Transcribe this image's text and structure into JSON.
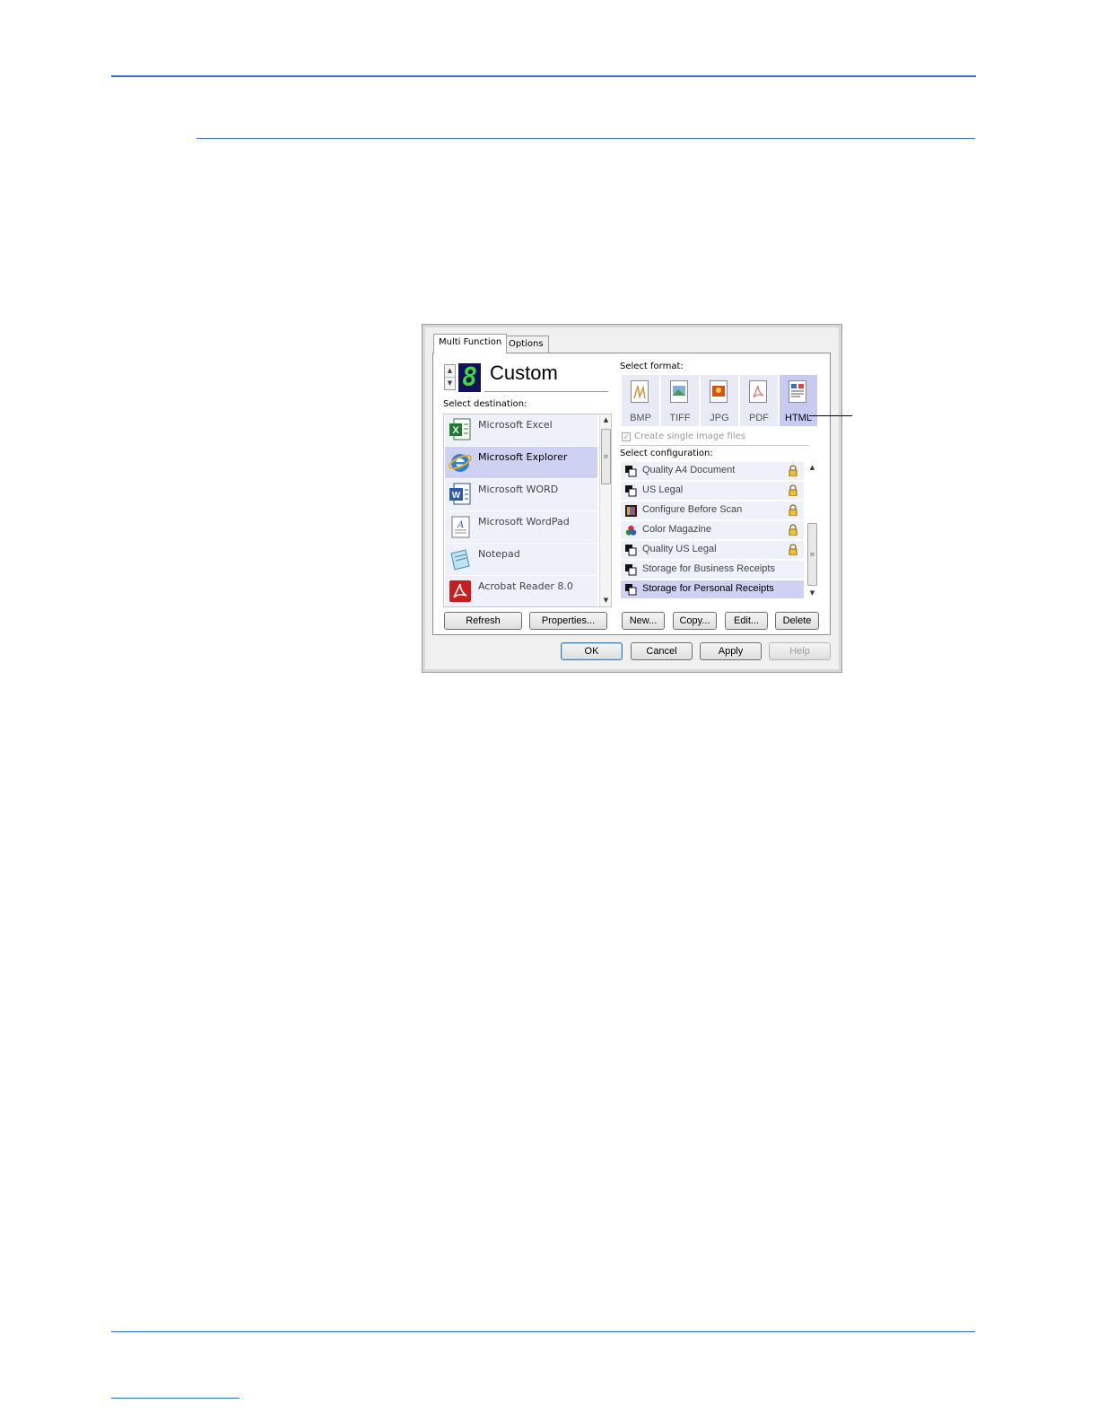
{
  "dialog": {
    "tabs": [
      {
        "label": "Multi Function",
        "active": true
      },
      {
        "label": "Options",
        "active": false
      }
    ],
    "profile": {
      "digit": "8",
      "name": "Custom"
    },
    "destination": {
      "label": "Select destination:",
      "items": [
        {
          "label": "Microsoft Excel",
          "icon": "excel-icon",
          "selected": false
        },
        {
          "label": "Microsoft Explorer",
          "icon": "internet-explorer-icon",
          "selected": true
        },
        {
          "label": "Microsoft WORD",
          "icon": "word-icon",
          "selected": false
        },
        {
          "label": "Microsoft WordPad",
          "icon": "wordpad-icon",
          "selected": false
        },
        {
          "label": "Notepad",
          "icon": "notepad-icon",
          "selected": false
        },
        {
          "label": "Acrobat Reader 8.0",
          "icon": "acrobat-icon",
          "selected": false
        }
      ],
      "buttons": {
        "refresh": "Refresh",
        "properties": "Properties..."
      }
    },
    "format": {
      "label": "Select format:",
      "items": [
        {
          "label": "BMP",
          "icon": "bmp-icon",
          "selected": false
        },
        {
          "label": "TIFF",
          "icon": "tiff-icon",
          "selected": false
        },
        {
          "label": "JPG",
          "icon": "jpg-icon",
          "selected": false
        },
        {
          "label": "PDF",
          "icon": "pdf-icon",
          "selected": false
        },
        {
          "label": "HTML",
          "icon": "html-icon",
          "selected": true
        }
      ],
      "single_image_label": "Create single image files",
      "single_image_checked": true
    },
    "configuration": {
      "label": "Select configuration:",
      "items": [
        {
          "label": "Quality A4 Document",
          "icon": "scan-config-icon",
          "locked": true,
          "selected": false
        },
        {
          "label": "US Legal",
          "icon": "scan-config-icon",
          "locked": true,
          "selected": false
        },
        {
          "label": "Configure Before Scan",
          "icon": "configure-before-scan-icon",
          "locked": true,
          "selected": false
        },
        {
          "label": "Color Magazine",
          "icon": "color-config-icon",
          "locked": true,
          "selected": false
        },
        {
          "label": "Quality US Legal",
          "icon": "scan-config-icon",
          "locked": true,
          "selected": false
        },
        {
          "label": "Storage for Business Receipts",
          "icon": "scan-config-icon",
          "locked": false,
          "selected": false
        },
        {
          "label": "Storage for Personal Receipts",
          "icon": "scan-config-icon",
          "locked": false,
          "selected": true
        }
      ],
      "buttons": {
        "new": "New...",
        "copy": "Copy...",
        "edit": "Edit...",
        "delete": "Delete"
      }
    },
    "footer": {
      "ok": "OK",
      "cancel": "Cancel",
      "apply": "Apply",
      "help": "Help"
    }
  }
}
